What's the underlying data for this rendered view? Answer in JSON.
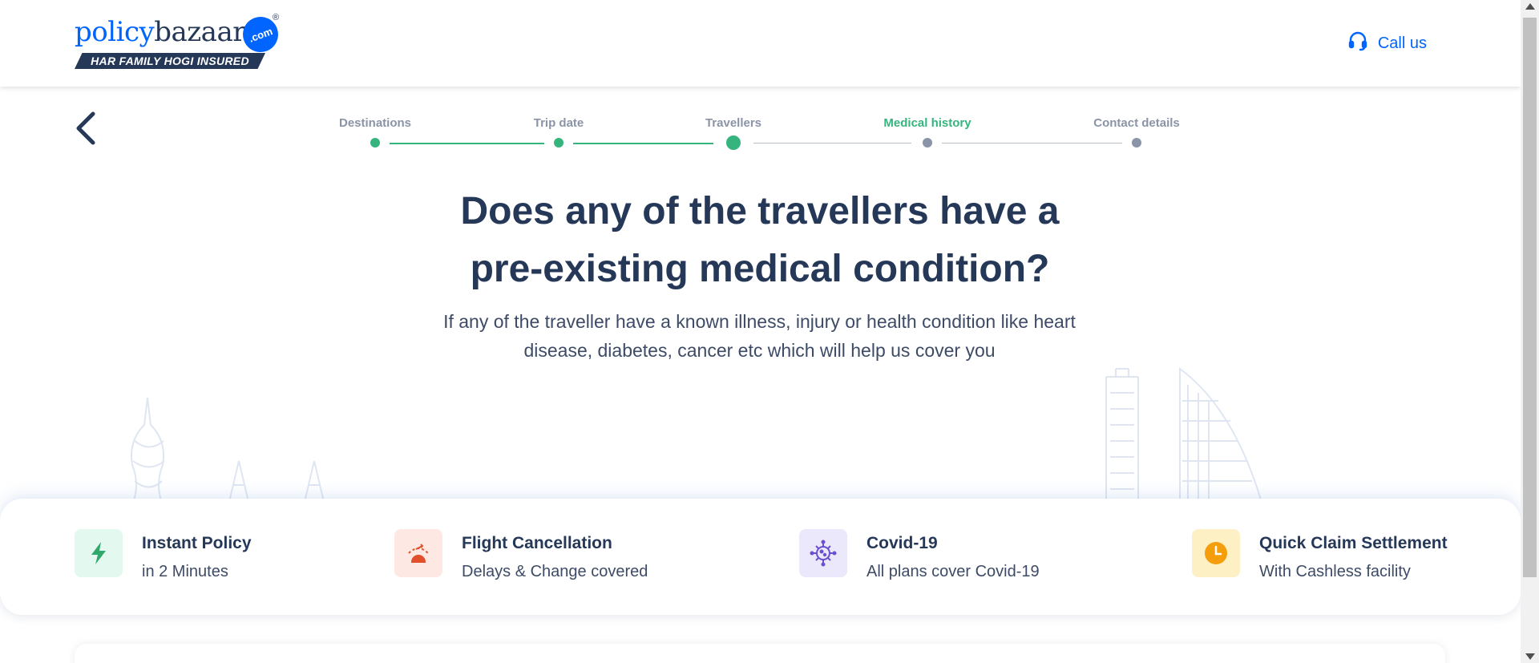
{
  "header": {
    "logo": {
      "word_policy": "policy",
      "word_bazaar": "bazaar",
      "com": ".com",
      "reg": "®",
      "tagline": "HAR FAMILY HOGI INSURED"
    },
    "call_label": "Call us"
  },
  "stepper": {
    "steps": [
      {
        "label": "Destinations",
        "state": "done"
      },
      {
        "label": "Trip date",
        "state": "done"
      },
      {
        "label": "Travellers",
        "state": "current"
      },
      {
        "label": "Medical history",
        "state": "active-label"
      },
      {
        "label": "Contact details",
        "state": "pending"
      }
    ]
  },
  "main": {
    "question_line1": "Does any of the travellers have a",
    "question_line2": "pre-existing medical condition?",
    "subtitle_line1": "If any of the traveller have a known illness, injury or health condition like heart",
    "subtitle_line2": "disease, diabetes, cancer etc which will help us cover you"
  },
  "features": [
    {
      "icon": "lightning-icon",
      "title": "Instant Policy",
      "subtitle": "in 2 Minutes",
      "bg": "#e3f8ee",
      "color": "#2fa86a"
    },
    {
      "icon": "flight-cancel-icon",
      "title": "Flight Cancellation",
      "subtitle": "Delays & Change covered",
      "bg": "#fde8e3",
      "color": "#e0502a"
    },
    {
      "icon": "virus-icon",
      "title": "Covid-19",
      "subtitle": "All plans cover Covid-19",
      "bg": "#ece8fb",
      "color": "#6b4fd1"
    },
    {
      "icon": "clock-icon",
      "title": "Quick Claim Settlement",
      "subtitle": "With Cashless facility",
      "bg": "#fdf0c4",
      "color": "#f59e0b"
    }
  ],
  "colors": {
    "brand_blue": "#0065ff",
    "navy": "#253858",
    "green": "#35b47e",
    "grey": "#8a94a6"
  }
}
